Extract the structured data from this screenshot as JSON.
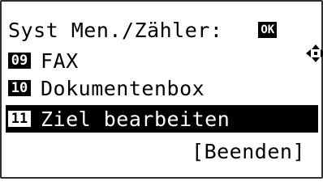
{
  "title": "Syst Men./Zähler:",
  "nav_icon": "four-way-arrow-icon",
  "ok_label": "OK",
  "menu": {
    "items": [
      {
        "number": "09",
        "label": "FAX"
      },
      {
        "number": "10",
        "label": "Dokumentenbox"
      },
      {
        "number": "11",
        "label": "Ziel bearbeiten"
      }
    ],
    "selected_index": 2
  },
  "exit_label": "[Beenden]"
}
